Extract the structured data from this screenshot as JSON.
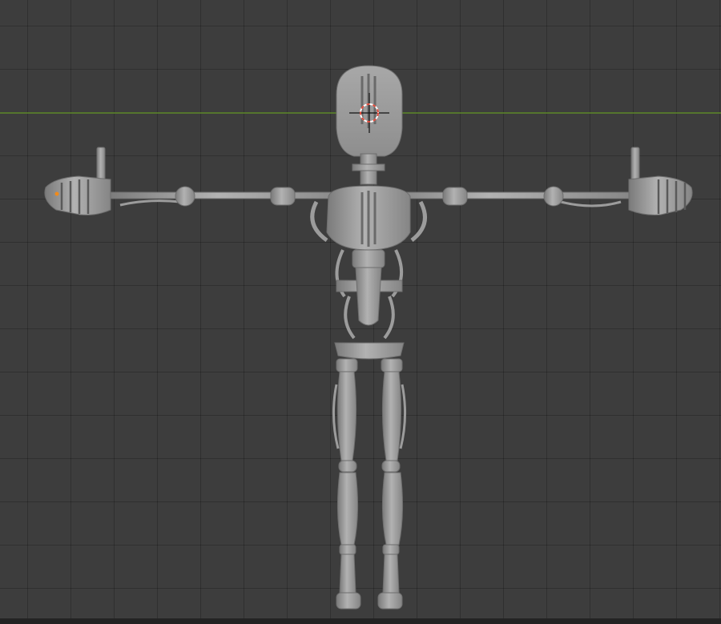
{
  "viewport": {
    "background_color": "#3d3d3d",
    "grid_color": "#333333",
    "x_axis_color": "#5f8a2a",
    "model_color": "#a6a6a6",
    "cursor_ring_color": "#e04a3a",
    "origin_dot_color": "#f08a1a"
  },
  "scene": {
    "object": "robot-armature-tpose",
    "view": "front-orthographic"
  }
}
